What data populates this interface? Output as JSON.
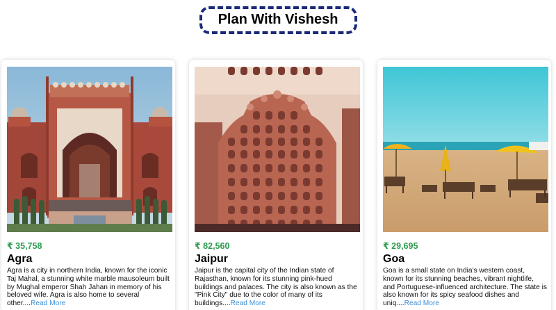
{
  "header": {
    "title": "Plan With Vishesh"
  },
  "cards": [
    {
      "price": "₹ 35,758",
      "city": "Agra",
      "description": "Agra is a city in northern India, known for the iconic Taj Mahal, a stunning white marble mausoleum built by Mughal emperor Shah Jahan in memory of his beloved wife. Agra is also home to several other....",
      "read_more": "Read More"
    },
    {
      "price": "₹ 82,560",
      "city": "Jaipur",
      "description": "Jaipur is the capital city of the Indian state of Rajasthan, known for its stunning pink-hued buildings and palaces. The city is also known as the \"Pink City\" due to the color of many of its buildings....",
      "read_more": "Read More"
    },
    {
      "price": "₹ 29,695",
      "city": "Goa",
      "description": "Goa is a small state on India's western coast, known for its stunning beaches, vibrant nightlife, and Portuguese-influenced architecture. The state is also known for its spicy seafood dishes and uniq....",
      "read_more": "Read More"
    }
  ],
  "colors": {
    "title_border": "#1b2a7a",
    "price": "#2e9a4e",
    "link": "#3b8fd6"
  }
}
